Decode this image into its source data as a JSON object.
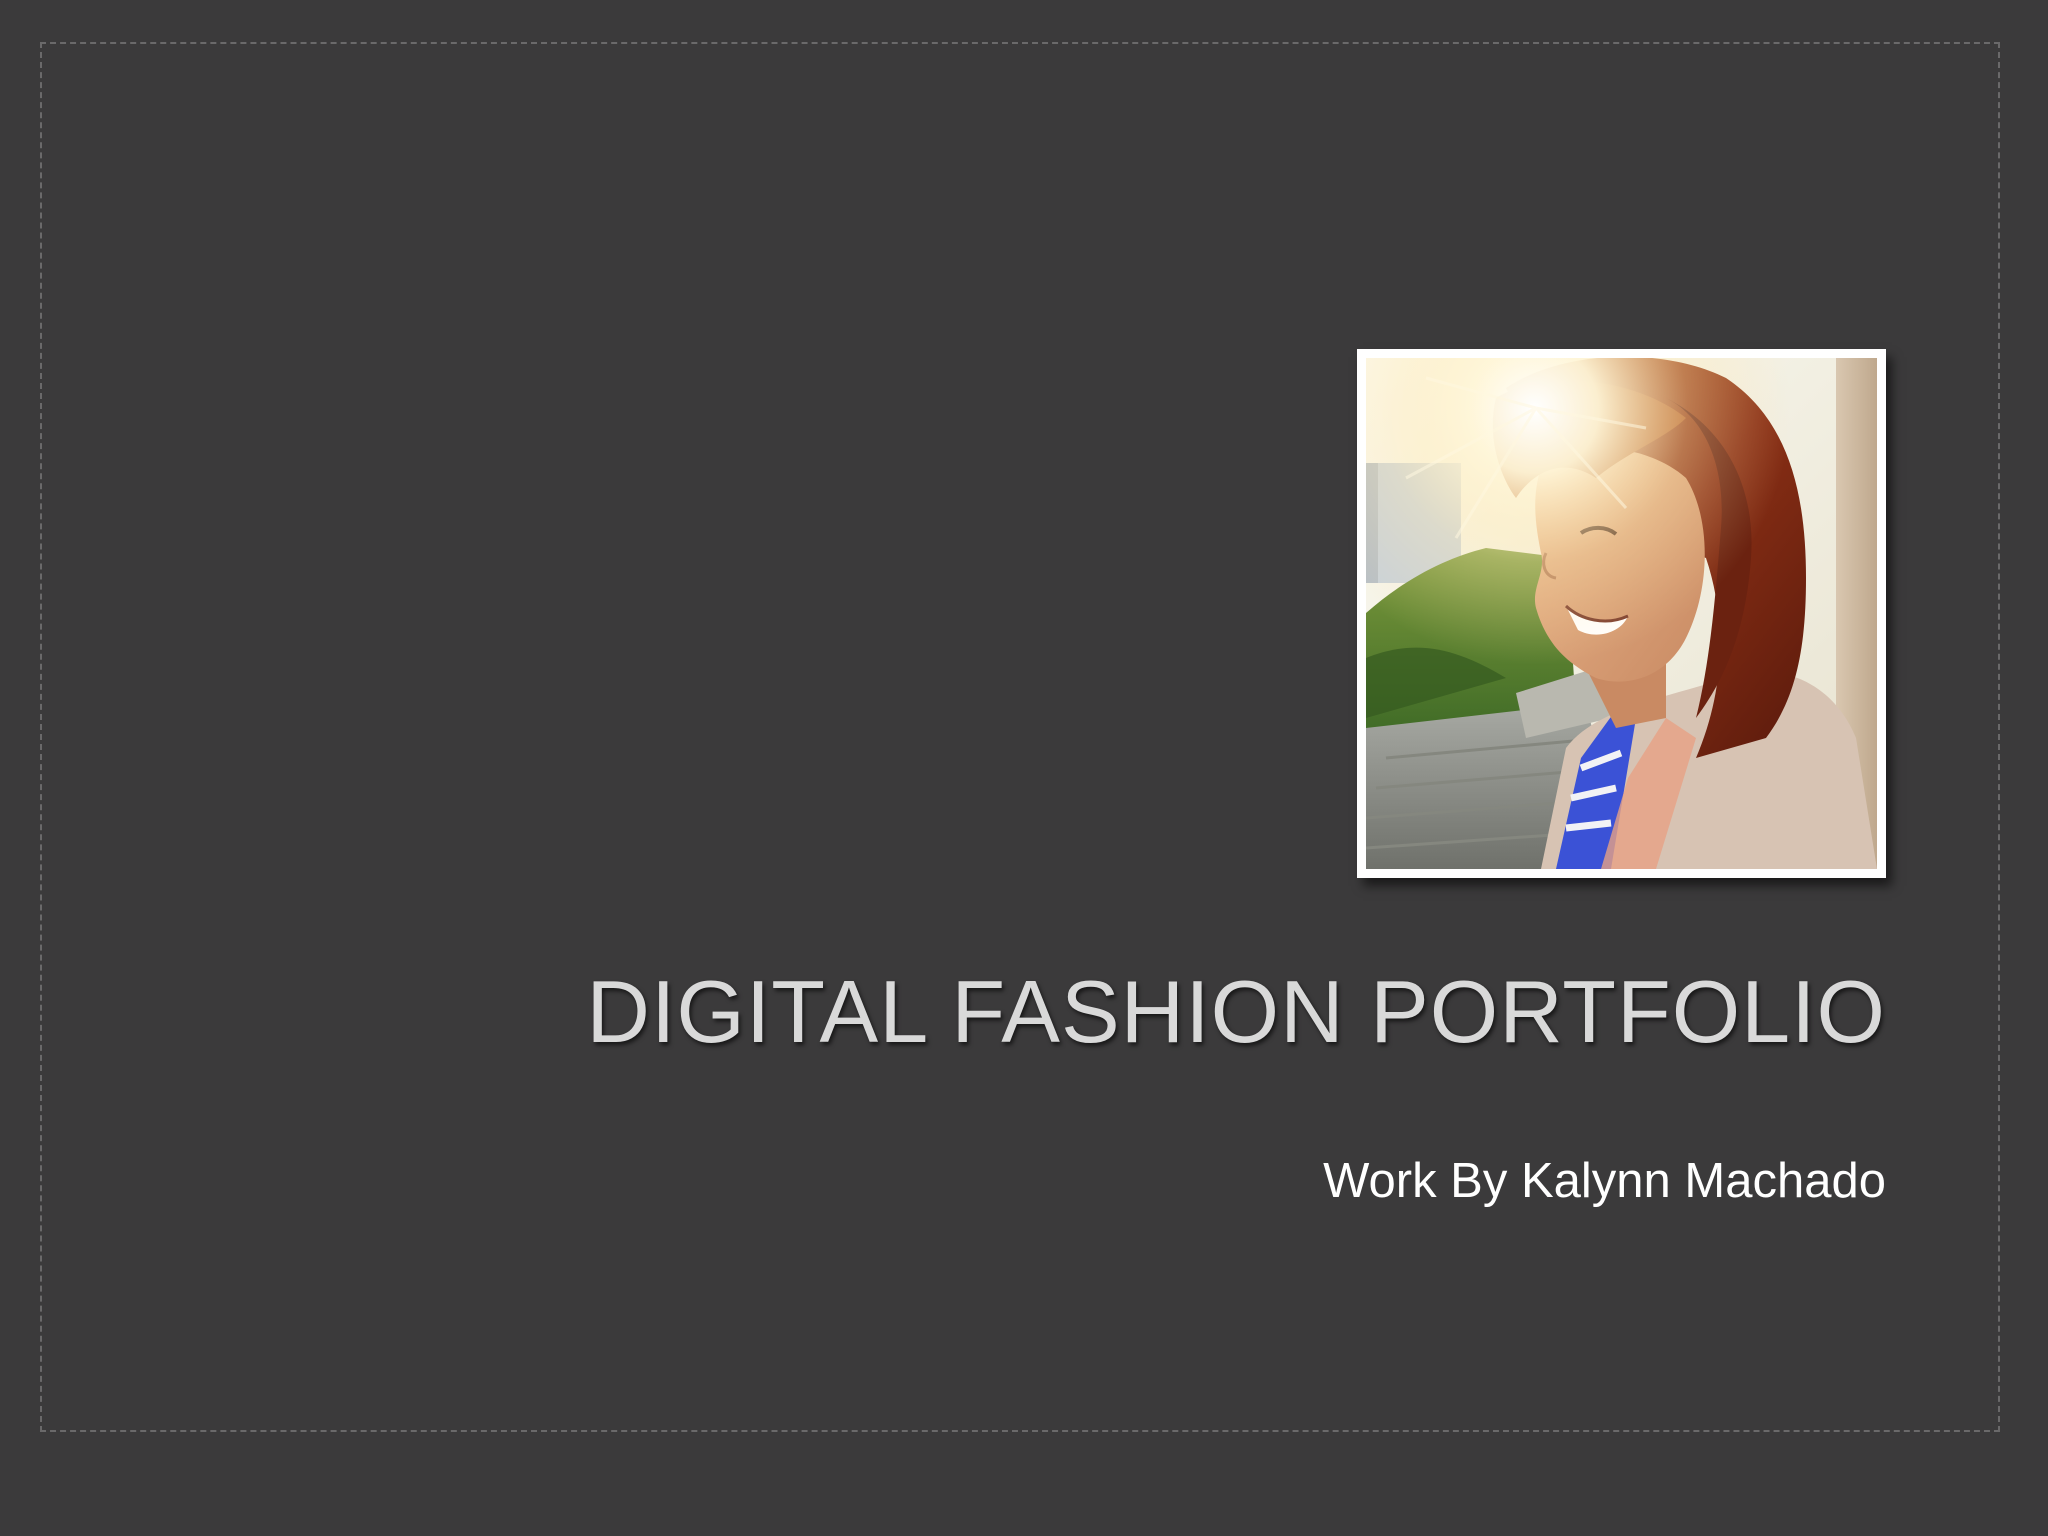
{
  "slide": {
    "title": "DIGITAL FASHION PORTFOLIO",
    "subtitle": "Work By Kalynn Machado",
    "photo_alt": "Portrait photo of a smiling woman with shoulder-length auburn hair, backlit by the sun"
  },
  "colors": {
    "background": "#3b3a3b",
    "title": "#d9d9d9",
    "subtitle": "#ffffff",
    "frame_border": "#6a696a"
  }
}
